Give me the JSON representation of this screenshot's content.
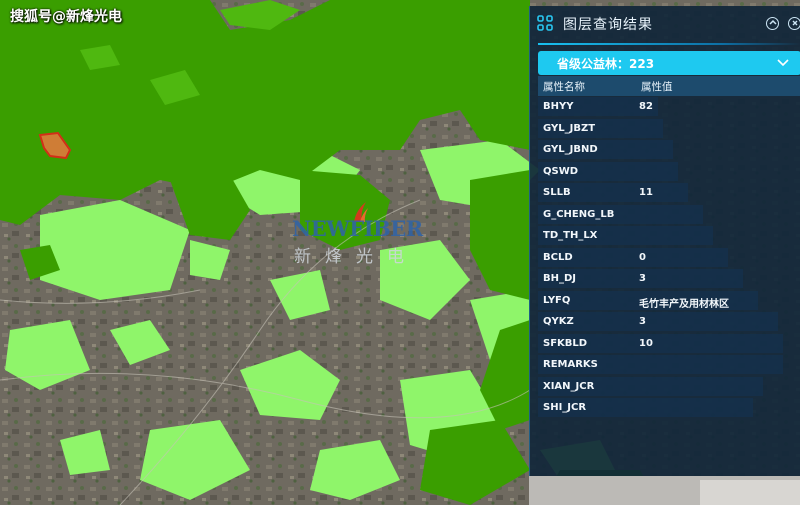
{
  "watermark": "搜狐号@新烽光电",
  "logo": {
    "en": "NEWFIBER",
    "cn": "新烽光电"
  },
  "panel": {
    "title": "图层查询结果",
    "collapse_icon": "chevron-up-circle-icon",
    "close_icon": "close-circle-icon",
    "layer_select": "省级公益林：223",
    "columns": {
      "name": "属性名称",
      "value": "属性值"
    },
    "rows": [
      {
        "name": "BHYY",
        "value": "82"
      },
      {
        "name": "GYL_JBZT",
        "value": ""
      },
      {
        "name": "GYL_JBND",
        "value": ""
      },
      {
        "name": "QSWD",
        "value": ""
      },
      {
        "name": "SLLB",
        "value": "11"
      },
      {
        "name": "G_CHENG_LB",
        "value": ""
      },
      {
        "name": "TD_TH_LX",
        "value": ""
      },
      {
        "name": "BCLD",
        "value": "0"
      },
      {
        "name": "BH_DJ",
        "value": "3"
      },
      {
        "name": "LYFQ",
        "value": "毛竹丰产及用材林区"
      },
      {
        "name": "QYKZ",
        "value": "3"
      },
      {
        "name": "SFKBLD",
        "value": "10"
      },
      {
        "name": "REMARKS",
        "value": ""
      },
      {
        "name": "XIAN_JCR",
        "value": ""
      },
      {
        "name": "SHI_JCR",
        "value": ""
      }
    ]
  },
  "colors": {
    "forest_dark": "#3a9e00",
    "forest_light": "#8ff56a",
    "selected_fill": "#e07a3c",
    "selected_stroke": "#e3241b",
    "accent": "#1ec9f0"
  }
}
